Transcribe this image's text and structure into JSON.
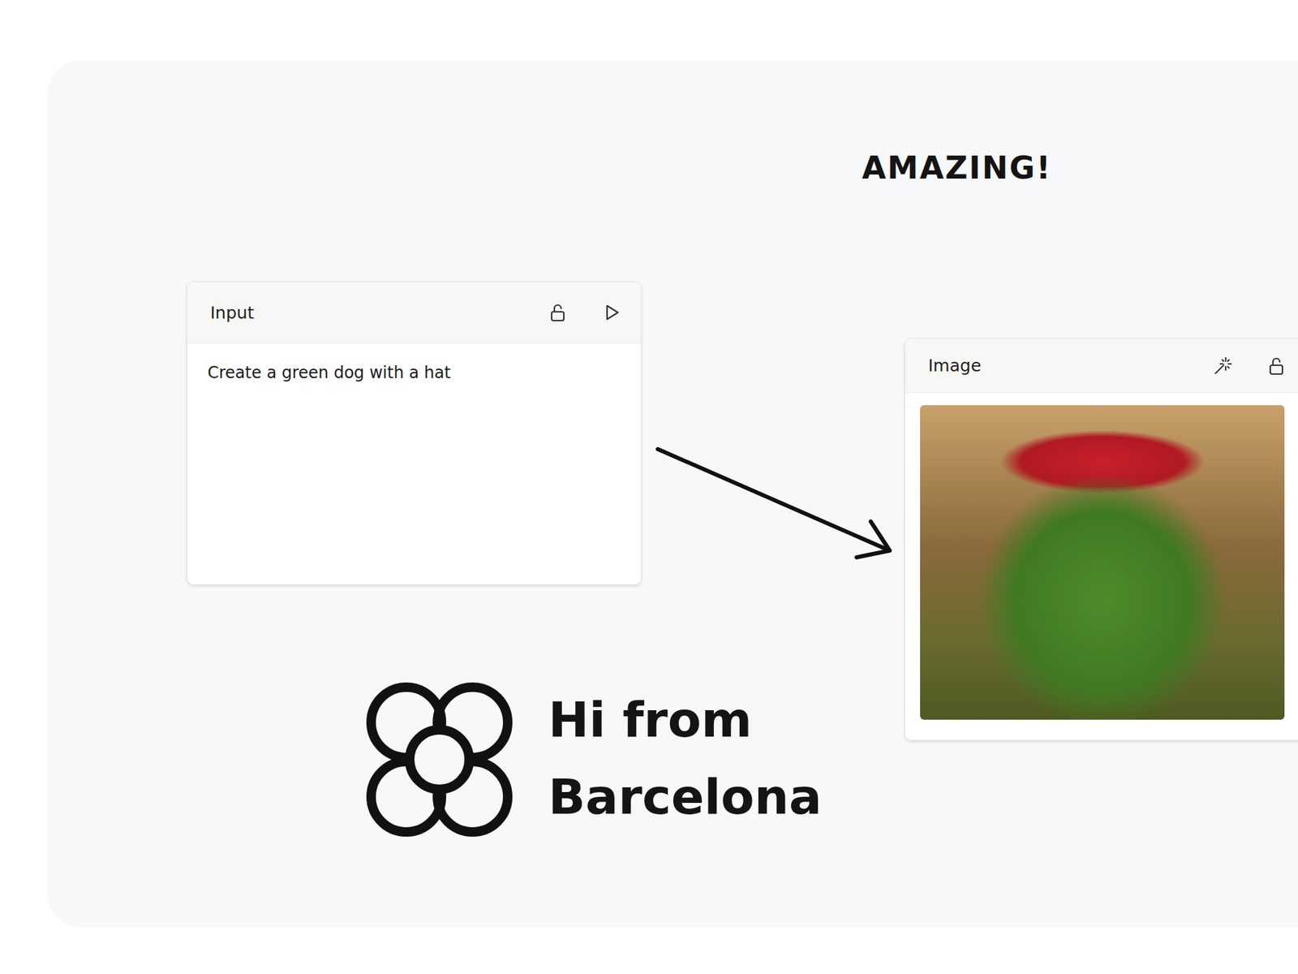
{
  "canvas": {
    "notes": [
      {
        "text": "AMAZING!"
      }
    ],
    "sticker": {
      "lines": [
        "Hi from",
        "Barcelona"
      ]
    }
  },
  "nodes": [
    {
      "kind": "input",
      "title": "Input",
      "locked": false,
      "prompt": "Create a green dog with a hat"
    },
    {
      "kind": "image",
      "title": "Image",
      "locked": false
    }
  ]
}
